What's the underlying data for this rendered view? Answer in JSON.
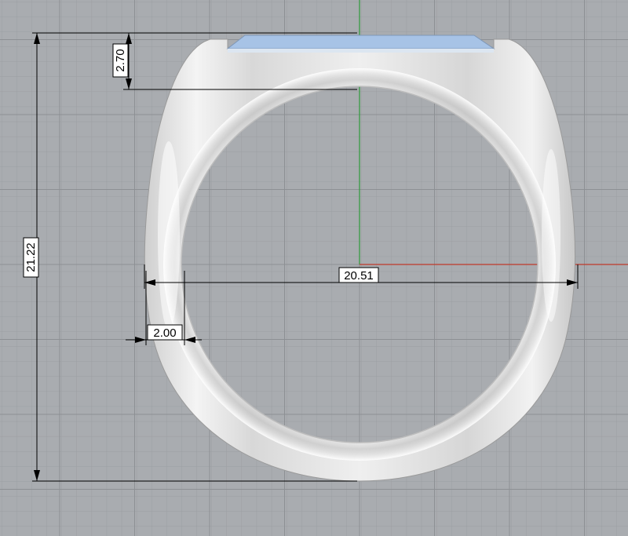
{
  "viewport": {
    "background": "#a9acb0",
    "grid_minor_color": "#9a9da1",
    "grid_major_color": "#8c8f93",
    "x_axis_color": "#c0392b",
    "y_axis_color": "#2e9a3a"
  },
  "ring": {
    "metal_color": "#e6e6e6",
    "face_color": "#a7c3e6"
  },
  "dimensions": {
    "top_thickness": "2.70",
    "overall_height": "21.22",
    "overall_width": "20.51",
    "band_width": "2.00"
  }
}
